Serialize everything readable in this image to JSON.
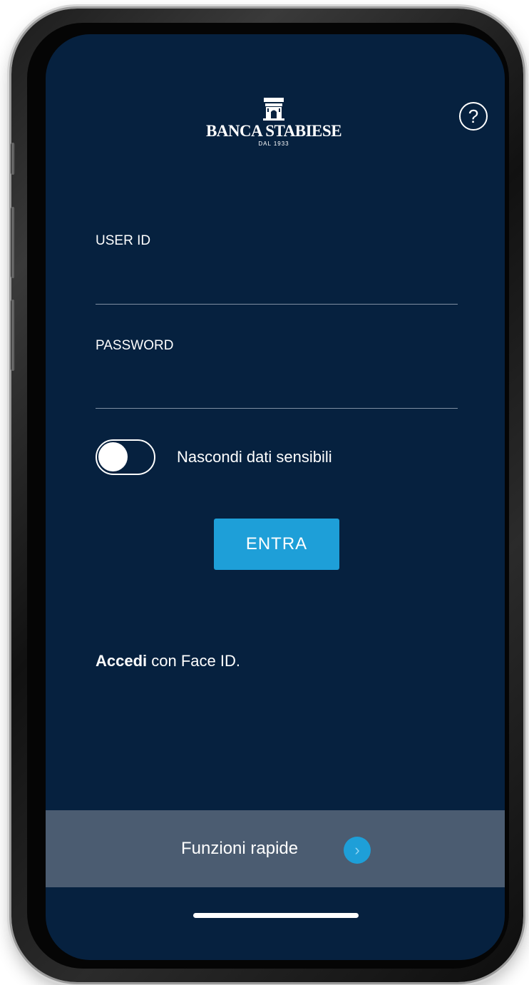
{
  "brand": {
    "name": "BANCA STABIESE",
    "tagline": "DAL 1933"
  },
  "header": {
    "help_icon_glyph": "?"
  },
  "login": {
    "user_label": "USER ID",
    "user_value": "",
    "password_label": "PASSWORD",
    "password_value": "",
    "hide_data_label": "Nascondi dati sensibili",
    "hide_data_on": false,
    "enter_label": "ENTRA",
    "faceid_bold": "Accedi",
    "faceid_rest": " con Face ID."
  },
  "quick_actions": {
    "label": "Funzioni rapide",
    "chevron_glyph": "›"
  },
  "colors": {
    "background": "#06213f",
    "accent": "#1e9fd8",
    "bar": "#4b5c71"
  },
  "icons": {
    "help": "help-icon",
    "logo": "tower-logo-icon",
    "quick": "chevron-right-icon"
  }
}
